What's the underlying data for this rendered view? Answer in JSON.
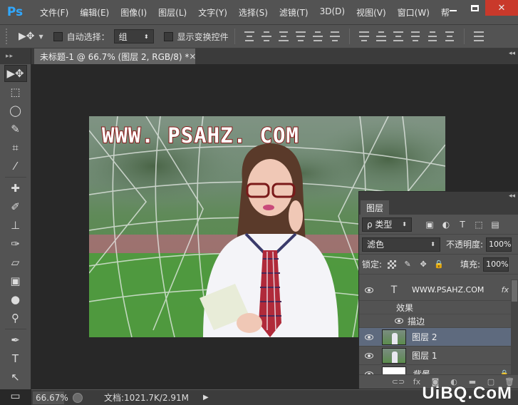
{
  "app": {
    "logo": "Ps"
  },
  "menu": [
    "文件(F)",
    "编辑(E)",
    "图像(I)",
    "图层(L)",
    "文字(Y)",
    "选择(S)",
    "滤镜(T)",
    "3D(D)",
    "视图(V)",
    "窗口(W)",
    "帮"
  ],
  "window_controls": {
    "close": "✕"
  },
  "options": {
    "auto_select_label": "自动选择：",
    "auto_select_value": "组",
    "transform_label": "显示变换控件"
  },
  "document": {
    "tab_title": "未标题-1 @ 66.7% (图层 2, RGB/8) *",
    "tab_close": "×",
    "watermark_text": "WWW. PSAHZ. COM"
  },
  "status": {
    "zoom": "66.67%",
    "doc_info": "文档:1021.7K/2.91M"
  },
  "layers_panel": {
    "tab": "图层",
    "filter_kind": "ρ 类型",
    "blend_mode": "滤色",
    "opacity_label": "不透明度:",
    "opacity_value": "100%",
    "lock_label": "锁定:",
    "fill_label": "填充:",
    "fill_value": "100%",
    "layers": [
      {
        "name": "WWW.PSAHZ.COM",
        "type": "text",
        "fx": "fx",
        "effects_label": "效果",
        "effect": "描边"
      },
      {
        "name": "图层 2",
        "type": "image",
        "selected": true
      },
      {
        "name": "图层 1",
        "type": "image"
      },
      {
        "name": "背景",
        "type": "background"
      }
    ]
  },
  "site_watermark": "UiBQ.CoM",
  "colors": {
    "ui_dark": "#282828",
    "ui_panel": "#535353",
    "selection": "#5e6a7e",
    "ps_blue": "#31a8ff",
    "close_red": "#c9392b"
  }
}
